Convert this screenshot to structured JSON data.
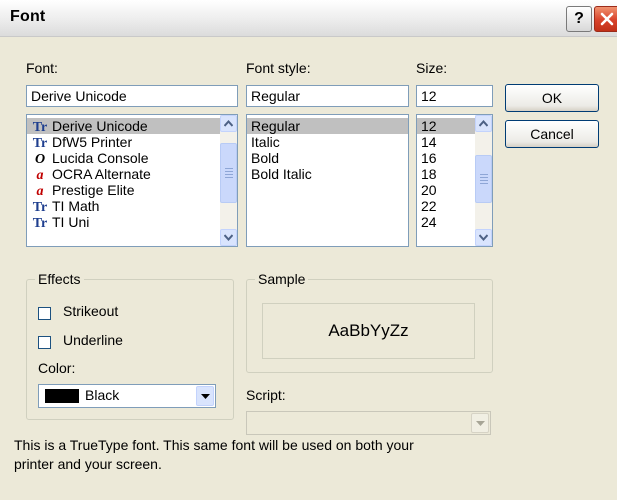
{
  "window": {
    "title": "Font",
    "help_label": "?",
    "help_icon": "question-mark-icon",
    "close_icon": "close-x-icon"
  },
  "font": {
    "label": "Font:",
    "value": "Derive Unicode",
    "items": [
      {
        "name": "Derive Unicode",
        "icon": "truetype-icon",
        "selected": true
      },
      {
        "name": "DfW5 Printer",
        "icon": "truetype-icon",
        "selected": false
      },
      {
        "name": "Lucida Console",
        "icon": "opentype-icon",
        "selected": false
      },
      {
        "name": "OCRA Alternate",
        "icon": "printer-font-icon",
        "selected": false
      },
      {
        "name": "Prestige Elite",
        "icon": "printer-font-icon",
        "selected": false
      },
      {
        "name": "TI Math",
        "icon": "truetype-icon",
        "selected": false
      },
      {
        "name": "TI Uni",
        "icon": "truetype-icon",
        "selected": false
      }
    ]
  },
  "style": {
    "label": "Font style:",
    "value": "Regular",
    "items": [
      "Regular",
      "Italic",
      "Bold",
      "Bold Italic"
    ],
    "selected": "Regular"
  },
  "size": {
    "label": "Size:",
    "value": "12",
    "items": [
      "12",
      "14",
      "16",
      "18",
      "20",
      "22",
      "24"
    ],
    "selected": "12"
  },
  "buttons": {
    "ok": "OK",
    "cancel": "Cancel"
  },
  "effects": {
    "title": "Effects",
    "strikeout": "Strikeout",
    "strikeout_checked": false,
    "underline": "Underline",
    "underline_checked": false,
    "color_label": "Color:",
    "color_value": "Black",
    "color_hex": "#000000"
  },
  "sample": {
    "title": "Sample",
    "text": "AaBbYyZz"
  },
  "script": {
    "label": "Script:",
    "value": "",
    "disabled": true
  },
  "description": {
    "line1": "This is a TrueType font. This same font will be used on both your",
    "line2": "printer and your screen."
  },
  "colors": {
    "dialog_bg": "#ece9d8",
    "selection": "#c0c0c0",
    "input_border": "#7f9db9",
    "close_red": "#d8422a",
    "truetype_blue": "#1f3f8f",
    "printer_red": "#c00000"
  }
}
